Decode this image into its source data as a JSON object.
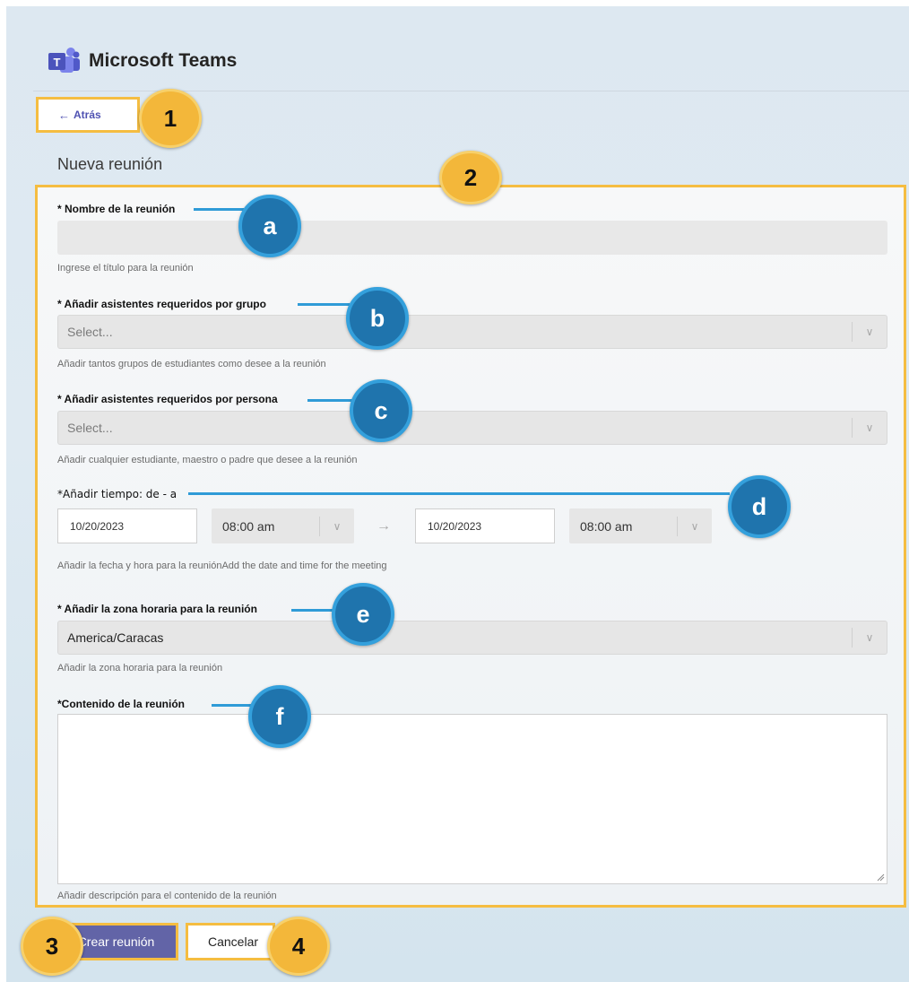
{
  "app": {
    "title": "Microsoft Teams"
  },
  "nav": {
    "back_label": "Atrás"
  },
  "page": {
    "title": "Nueva reunión"
  },
  "form": {
    "name": {
      "label": "* Nombre de la reunión",
      "value": "",
      "hint": "Ingrese el título para la reunión"
    },
    "groups": {
      "label": "* Añadir asistentes requeridos por grupo",
      "placeholder": "Select...",
      "hint": "Añadir tantos grupos de estudiantes como desee a la reunión"
    },
    "persons": {
      "label": "* Añadir asistentes requeridos por persona",
      "placeholder": "Select...",
      "hint": "Añadir cualquier estudiante, maestro o padre que desee a la reunión"
    },
    "time": {
      "label": "*Añadir tiempo: de - a",
      "start_date": "10/20/2023",
      "start_time": "08:00 am",
      "end_date": "10/20/2023",
      "end_time": "08:00 am",
      "hint": "Añadir la fecha y hora para la reuniónAdd the date and time for the meeting"
    },
    "timezone": {
      "label": "* Añadir la zona horaria para la reunión",
      "value": "America/Caracas",
      "hint": "Añadir la zona horaria para la reunión"
    },
    "content": {
      "label": "*Contenido de la reunión",
      "value": "",
      "hint": "Añadir descripción para el contenido de la reunión"
    }
  },
  "actions": {
    "create_label": "Crear reunión",
    "cancel_label": "Cancelar"
  },
  "callouts": {
    "numbers": [
      "1",
      "2",
      "3",
      "4"
    ],
    "letters": [
      "a",
      "b",
      "c",
      "d",
      "e",
      "f"
    ]
  },
  "colors": {
    "accent": "#6264a7",
    "callout_border": "#f5bd41",
    "callout_number_bg": "#f3b73a",
    "callout_letter_bg": "#1f74ad"
  },
  "icons": {
    "logo": "teams-logo-icon",
    "back": "arrow-left-icon",
    "dropdown": "chevron-down-icon",
    "range": "arrow-right-icon",
    "resize": "resize-grip-icon"
  }
}
